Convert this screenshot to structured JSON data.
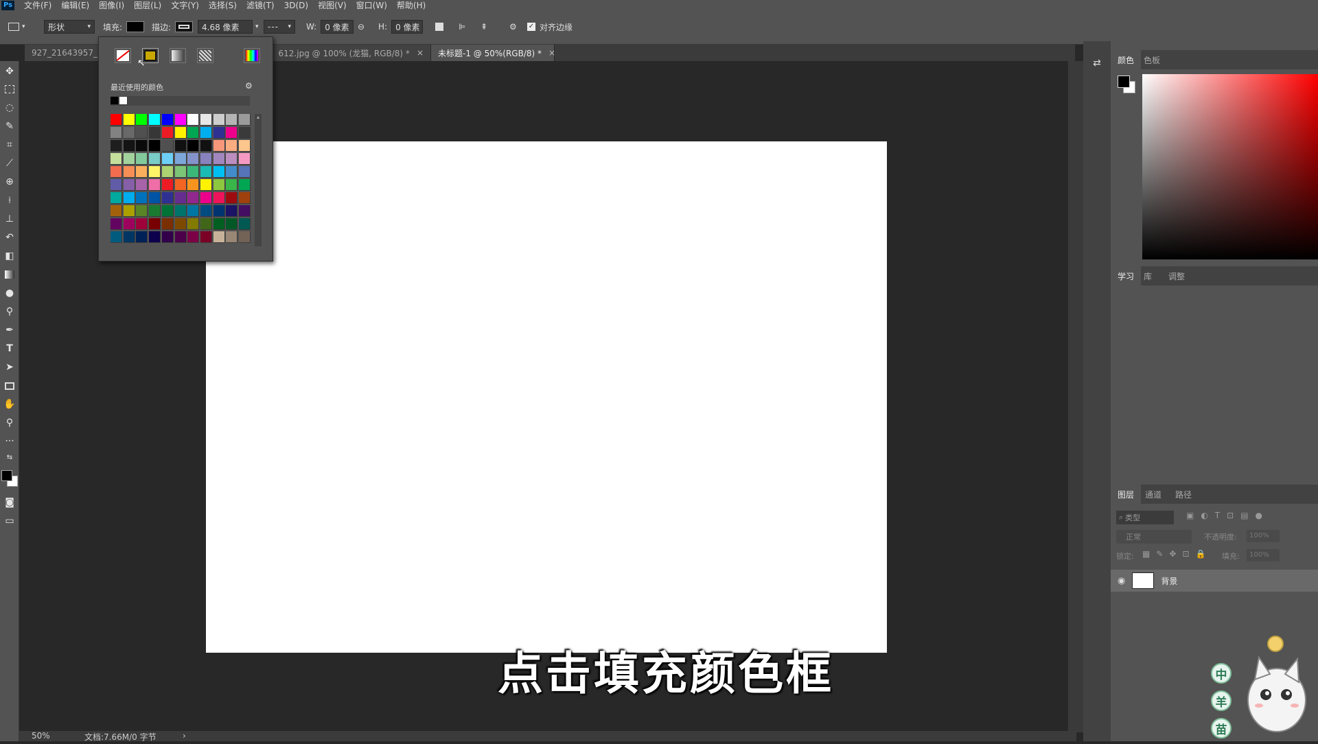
{
  "menubar": {
    "logo": "Ps",
    "items": [
      "文件(F)",
      "编辑(E)",
      "图像(I)",
      "图层(L)",
      "文字(Y)",
      "选择(S)",
      "滤镜(T)",
      "3D(D)",
      "视图(V)",
      "窗口(W)",
      "帮助(H)"
    ]
  },
  "options": {
    "mode": "形状",
    "fill_label": "填充:",
    "stroke_label": "描边:",
    "stroke_width": "4.68 像素",
    "w_label": "W:",
    "w_value": "0 像素",
    "h_label": "H:",
    "h_value": "0 像素",
    "align_edges": "对齐边缘"
  },
  "tabs": [
    {
      "label": "927_21643957_"
    },
    {
      "label": "612.jpg @ 100% (龙猫, RGB/8) *",
      "close": "×"
    },
    {
      "label": "未标题-1 @ 50%(RGB/8) *",
      "close": "×"
    }
  ],
  "popup": {
    "recent_label": "最近使用的颜色",
    "recent": [
      "#000000",
      "#ffffff"
    ],
    "swatches": [
      [
        "#ff0000",
        "#ffff00",
        "#00ff00",
        "#00ffff",
        "#0000ff",
        "#ff00ff",
        "#ffffff",
        "#e6e6e6",
        "#cdcdcd",
        "#b4b4b4",
        "#9b9b9b"
      ],
      [
        "#828282",
        "#696969",
        "#505050",
        "#373737",
        "#ed1c24",
        "#fff200",
        "#00a651",
        "#00aeef",
        "#2e3192",
        "#ec008c",
        "#3a3a3a"
      ],
      [
        "#1e1e1e",
        "#141414",
        "#0a0a0a",
        "#000000",
        "#505050",
        "#111111",
        "#000000",
        "#111111",
        "#f7977a",
        "#fbad82",
        "#fdc68c"
      ],
      [
        "#c4df9b",
        "#a3d39c",
        "#82ca9c",
        "#7accc8",
        "#6dcff6",
        "#7da7d9",
        "#8493ca",
        "#8882be",
        "#a187be",
        "#bc8dbf",
        "#f49ac2"
      ],
      [
        "#f26c4f",
        "#f68e56",
        "#fbaf5c",
        "#fff467",
        "#acd372",
        "#7cc576",
        "#3bb878",
        "#1abbb4",
        "#00bff3",
        "#438ccb",
        "#5574b9"
      ],
      [
        "#605ca8",
        "#855fa8",
        "#a763a9",
        "#ef6ea8",
        "#ed1c24",
        "#f26522",
        "#f7941d",
        "#fff200",
        "#8dc63f",
        "#39b54a",
        "#00a651"
      ],
      [
        "#00a99d",
        "#00aeef",
        "#0072bc",
        "#0054a6",
        "#2e3192",
        "#662d91",
        "#92278f",
        "#ec008c",
        "#ed145b",
        "#9e0b0f",
        "#a0410d"
      ],
      [
        "#a36209",
        "#aba000",
        "#598527",
        "#1a7b30",
        "#007236",
        "#00746b",
        "#0076a3",
        "#004b80",
        "#003471",
        "#1b1464",
        "#440e62"
      ],
      [
        "#630460",
        "#9e005d",
        "#9e0039",
        "#790000",
        "#7b2e00",
        "#7d4900",
        "#827b00",
        "#406618",
        "#005e20",
        "#005826",
        "#005952"
      ],
      [
        "#005b7f",
        "#003663",
        "#002157",
        "#0d004c",
        "#32004b",
        "#4b0049",
        "#7b0046",
        "#7a0026",
        "#c7b299",
        "#998675",
        "#736357"
      ]
    ]
  },
  "right_panel": {
    "color_tabs": [
      "颜色",
      "色板"
    ],
    "learn_tabs": [
      "学习",
      "库",
      "调整"
    ],
    "layer_tabs": [
      "图层",
      "通道",
      "路径"
    ],
    "layer_filter": "类型",
    "blend_mode": "正常",
    "opacity_label": "不透明度:",
    "opacity_value": "100%",
    "lock_label": "锁定:",
    "fill_label": "填充:",
    "fill_value": "100%",
    "layer_name": "背景"
  },
  "status": {
    "zoom": "50%",
    "doc": "文档:7.66M/0 字节"
  },
  "subtitle": "点击填充颜色框",
  "mascot": {
    "chars": [
      "中",
      "羊",
      "苗"
    ]
  }
}
